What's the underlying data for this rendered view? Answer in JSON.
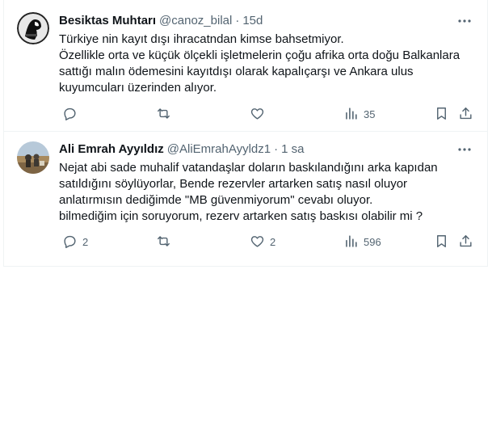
{
  "tweets": [
    {
      "name": "Besiktas Muhtarı",
      "handle": "@canoz_bilal",
      "dot": "·",
      "time": "15d",
      "lines": [
        "Türkiye nin kayıt dışı ihracatndan kimse bahsetmiyor.",
        "Özellikle orta ve küçük ölçekli işletmelerin çoğu afrika orta doğu Balkanlara",
        "sattığı malın ödemesini kayıtdışı olarak kapalıçarşı ve Ankara ulus",
        "kuyumcuları üzerinden alıyor."
      ],
      "replies": "",
      "retweets": "",
      "likes": "",
      "views": "35"
    },
    {
      "name": "Ali Emrah Ayyıldız",
      "handle": "@AliEmrahAyyldz1",
      "dot": "·",
      "time": "1 sa",
      "lines": [
        "Nejat abi sade muhalif vatandaşlar doların baskılandığını arka kapıdan",
        "satıldığını söylüyorlar, Bende rezervler artarken satış nasıl oluyor",
        "anlatırmısın dediğimde \"MB güvenmiyorum\" cevabı oluyor.",
        "bilmediğim için soruyorum, rezerv artarken satış baskısı olabilir mi ?"
      ],
      "replies": "2",
      "retweets": "",
      "likes": "2",
      "views": "596"
    }
  ],
  "icons": {
    "more": "more-dots-icon",
    "reply": "reply-bubble-icon",
    "retweet": "retweet-arrows-icon",
    "like": "heart-icon",
    "views": "analytics-bars-icon",
    "bookmark": "bookmark-icon",
    "share": "share-upload-icon"
  },
  "colors": {
    "text": "#0f1419",
    "secondary": "#536471",
    "divider": "#eff3f4"
  }
}
